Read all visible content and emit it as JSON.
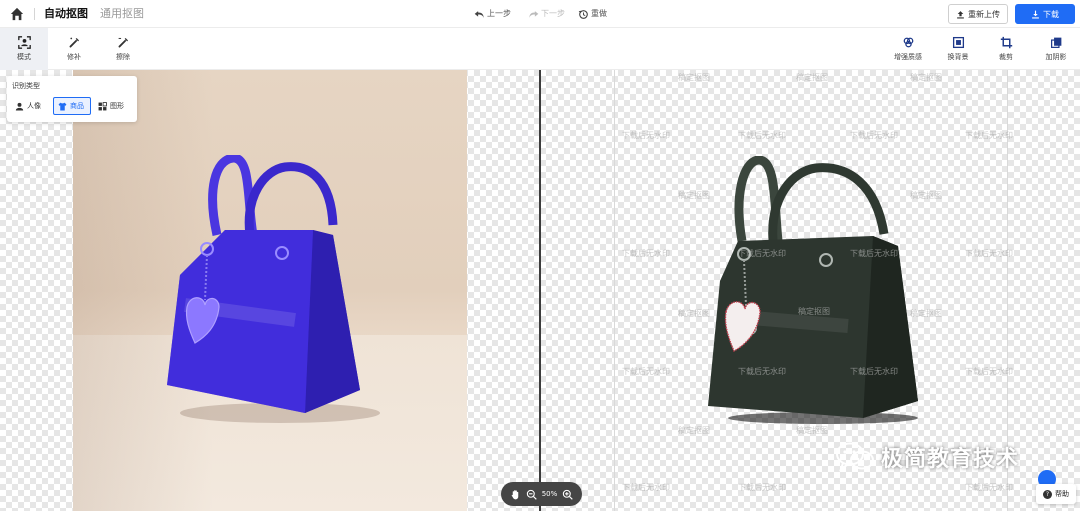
{
  "header": {
    "tab_active": "自动抠图",
    "tab_inactive": "通用抠图",
    "undo_label": "上一步",
    "redo_label": "下一步",
    "reset_label": "重做",
    "reupload_label": "重新上传",
    "download_label": "下载",
    "icons": {
      "home": "home-icon",
      "undo": "undo-icon",
      "redo": "redo-icon",
      "reset": "reset-icon",
      "upload": "upload-icon",
      "download": "download-icon"
    }
  },
  "toolbar": {
    "left": [
      {
        "label": "模式",
        "icon": "mode-icon",
        "active": true
      },
      {
        "label": "修补",
        "icon": "repair-brush-icon"
      },
      {
        "label": "擦除",
        "icon": "erase-brush-icon"
      }
    ],
    "right": [
      {
        "label": "增强质感",
        "icon": "enhance-icon"
      },
      {
        "label": "换背景",
        "icon": "background-icon"
      },
      {
        "label": "裁剪",
        "icon": "crop-icon"
      },
      {
        "label": "加阴影",
        "icon": "shadow-icon"
      }
    ]
  },
  "recognition_panel": {
    "title": "识别类型",
    "options": [
      {
        "label": "人像",
        "icon": "person-icon"
      },
      {
        "label": "商品",
        "icon": "shirt-icon",
        "selected": true
      },
      {
        "label": "图形",
        "icon": "shapes-icon"
      }
    ]
  },
  "zoom": {
    "value": "50%"
  },
  "watermarks": {
    "text_a": "稿定抠图",
    "text_b": "下载后无水印"
  },
  "brand": {
    "text": "极简教育技术"
  },
  "help": {
    "label": "帮助"
  },
  "colors": {
    "accent": "#1f6cf5",
    "bag_original": "#3f2ed6",
    "bag_cutout": "#2d352e"
  }
}
